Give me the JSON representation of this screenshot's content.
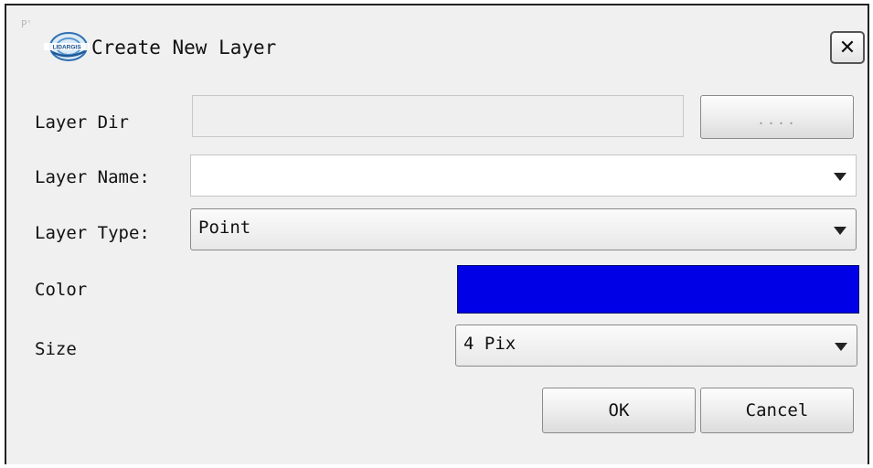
{
  "window": {
    "corner_mark": "P'",
    "title": "Create New Layer",
    "logo_text": "LIDARGIS",
    "close_label": "✕"
  },
  "form": {
    "layer_dir": {
      "label": "Layer Dir",
      "value": "",
      "browse_label": "...."
    },
    "layer_name": {
      "label": "Layer Name:",
      "value": ""
    },
    "layer_type": {
      "label": "Layer Type:",
      "value": "Point"
    },
    "color": {
      "label": "Color",
      "value_hex": "#0000e6"
    },
    "size": {
      "label": "Size",
      "value": "4 Pix"
    }
  },
  "buttons": {
    "ok_label": "OK",
    "cancel_label": "Cancel"
  },
  "icons": {
    "title_icon": "lidar-app-logo-icon",
    "close_icon": "close-icon",
    "dropdown_icon": "chevron-down-icon"
  }
}
